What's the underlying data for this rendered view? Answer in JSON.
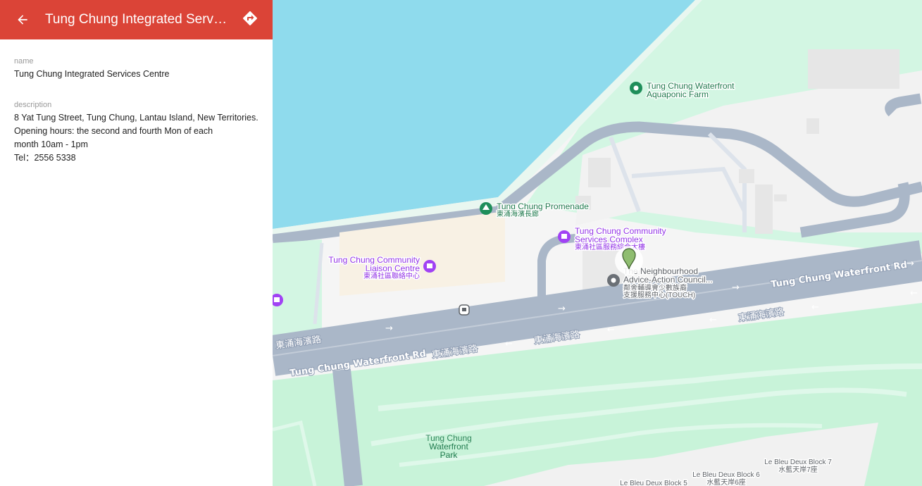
{
  "header": {
    "title": "Tung Chung Integrated Services Centre",
    "back_icon": "arrow-left-icon",
    "directions_icon": "directions-icon",
    "color": "#db4437"
  },
  "details": {
    "name_label": "name",
    "name_value": "Tung Chung Integrated Services Centre",
    "description_label": "description",
    "description_lines": [
      "8 Yat Tung Street, Tung Chung, Lantau Island, New Territories.",
      "Opening hours: the second and fourth Mon of each",
      "month 10am - 1pm",
      "Tel：2556 5338"
    ]
  },
  "map": {
    "colors": {
      "water": "#8fdbed",
      "park": "#ccf5df",
      "road": "#aab7c8",
      "land": "#f5f5f5"
    },
    "places": {
      "aquaponic_farm": [
        "Tung Chung Waterfront",
        "Aquaponic Farm"
      ],
      "promenade": [
        "Tung Chung Promenade",
        "東涌海濱長廊"
      ],
      "community_complex": [
        "Tung Chung Community",
        "Services Complex",
        "東涌社區服務綜合大樓"
      ],
      "liaison_centre": [
        "Tung Chung Community",
        "Liaison Centre",
        "東涌社區聯絡中心"
      ],
      "neighbourhood": [
        "The Neighbourhood",
        "Advice-Action Council...",
        "鄰舍輔導會少數族裔",
        "支援服務中心(TOUCH)"
      ],
      "waterfront_park": [
        "Tung Chung",
        "Waterfront",
        "Park"
      ],
      "block7": [
        "Le Bleu Deux Block 7",
        "水藍天岸7座"
      ],
      "block6": [
        "Le Bleu Deux Block 6",
        "水藍天岸6座"
      ],
      "block5": [
        "Le Bleu Deux Block 5"
      ]
    },
    "roads": {
      "waterfront_rd_en": "Tung Chung Waterfront Rd",
      "waterfront_rd_cn": "東涌海濱路"
    }
  }
}
